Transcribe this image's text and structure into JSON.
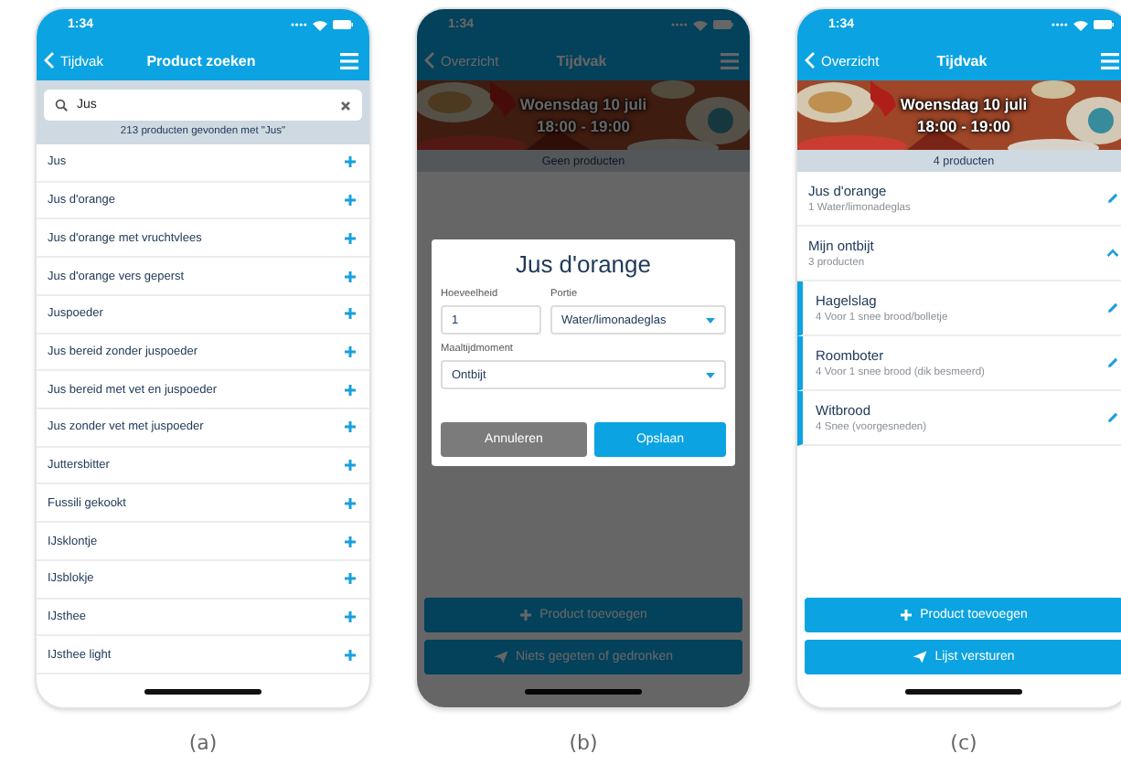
{
  "screens": [
    {
      "kind": "search",
      "caption": "(a)",
      "status_time": "1:34",
      "nav": {
        "back": "Tijdvak",
        "title": "Product zoeken"
      },
      "search": {
        "value": "Jus"
      },
      "result_count": "213 producten gevonden met \"Jus\"",
      "products": [
        "Jus",
        "Jus d'orange",
        "Jus d'orange met vruchtvlees",
        "Jus d'orange vers geperst",
        "Juspoeder",
        "Jus bereid zonder juspoeder",
        "Jus bereid met vet en juspoeder",
        "Jus zonder vet met juspoeder",
        "Juttersbitter",
        "Fussili gekookt",
        "IJsklontje",
        "IJsblokje",
        "IJsthee",
        "IJsthee light"
      ]
    },
    {
      "kind": "dialog",
      "caption": "(b)",
      "status_time": "1:34",
      "dimmed": true,
      "nav": {
        "back": "Overzicht",
        "title": "Tijdvak"
      },
      "banner": {
        "date": "Woensdag 10 juli",
        "time": "18:00 - 19:00"
      },
      "summary": "Geen producten",
      "dialog": {
        "title": "Jus d'orange",
        "fields": [
          {
            "label": "Hoeveelheid",
            "value": "1",
            "kind": "text"
          },
          {
            "label": "Portie",
            "value": "Water/limonadeglas",
            "kind": "select"
          },
          {
            "label": "Maaltijdmoment",
            "value": "Ontbijt",
            "kind": "select"
          }
        ],
        "buttons": [
          {
            "label": "Annuleren",
            "kind": "secondary"
          },
          {
            "label": "Opslaan",
            "kind": "primary"
          }
        ]
      },
      "actions": [
        {
          "label": "Product toevoegen",
          "kind": "add"
        },
        {
          "label": "Niets gegeten of gedronken",
          "kind": "send"
        }
      ]
    },
    {
      "kind": "list",
      "caption": "(c)",
      "status_time": "1:34",
      "nav": {
        "back": "Overzicht",
        "title": "Tijdvak"
      },
      "banner": {
        "date": "Woensdag 10 juli",
        "time": "18:00 - 19:00"
      },
      "summary": "4 producten",
      "entries": [
        {
          "kind": "item",
          "name": "Jus d'orange",
          "detail": "1 Water/limonadeglas"
        },
        {
          "kind": "group",
          "name": "Mijn ontbijt",
          "detail": "3 producten",
          "expanded": true,
          "children": [
            {
              "kind": "item",
              "name": "Hagelslag",
              "detail": "4 Voor 1 snee brood/bolletje"
            },
            {
              "kind": "item",
              "name": "Roomboter",
              "detail": "4 Voor 1 snee brood (dik besmeerd)"
            },
            {
              "kind": "item",
              "name": "Witbrood",
              "detail": "4 Snee (voorgesneden)"
            }
          ]
        }
      ],
      "actions": [
        {
          "label": "Product toevoegen",
          "kind": "add"
        },
        {
          "label": "Lijst versturen",
          "kind": "send"
        }
      ]
    }
  ]
}
